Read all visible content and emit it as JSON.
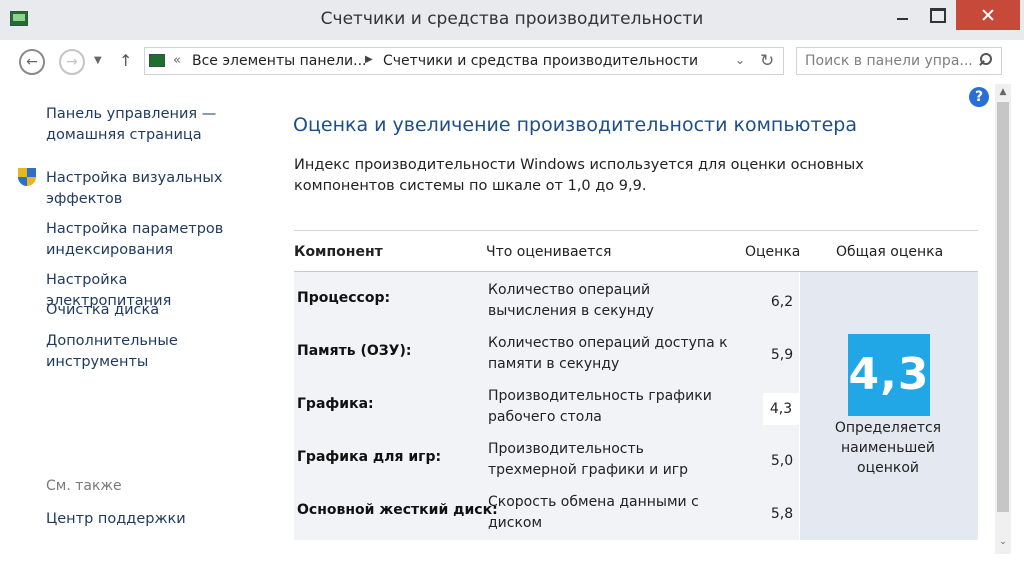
{
  "window": {
    "title": "Счетчики и средства производительности"
  },
  "nav": {
    "breadcrumb_1": "Все элементы панели...",
    "breadcrumb_2": "Счетчики и средства производительности",
    "search_placeholder": "Поиск в панели упра..."
  },
  "sidebar": {
    "home_link": "Панель управления — домашняя страница",
    "links": [
      "Настройка визуальных эффектов",
      "Настройка параметров индексирования",
      "Настройка электропитания",
      "Очистка диска",
      "Дополнительные инструменты"
    ],
    "see_also_label": "См. также",
    "see_also_links": [
      "Центр поддержки"
    ]
  },
  "main": {
    "title": "Оценка и увеличение производительности компьютера",
    "description": "Индекс производительности Windows используется для оценки основных компонентов системы по шкале от 1,0 до 9,9.",
    "columns": {
      "component": "Компонент",
      "what": "Что оценивается",
      "score": "Оценка",
      "base": "Общая оценка"
    },
    "rows": [
      {
        "component": "Процессор:",
        "what": "Количество операций вычисления в секунду",
        "score": "6,2"
      },
      {
        "component": "Память (ОЗУ):",
        "what": "Количество операций доступа к памяти в секунду",
        "score": "5,9"
      },
      {
        "component": "Графика:",
        "what": "Производительность графики рабочего стола",
        "score": "4,3"
      },
      {
        "component": "Графика для игр:",
        "what": "Производительность трехмерной графики и игр",
        "score": "5,0"
      },
      {
        "component": "Основной жесткий диск:",
        "what": "Скорость обмена данными с диском",
        "score": "5,8"
      }
    ],
    "base_score": "4,3",
    "base_caption": "Определяется наименьшей оценкой"
  },
  "colors": {
    "accent": "#21a7e6",
    "link": "#1e3a5f",
    "title": "#1e4e8a",
    "close_button": "#c7493a"
  },
  "icons": [
    "app-icon",
    "back-icon",
    "forward-icon",
    "up-icon",
    "refresh-icon",
    "search-icon",
    "shield-icon",
    "help-icon"
  ]
}
